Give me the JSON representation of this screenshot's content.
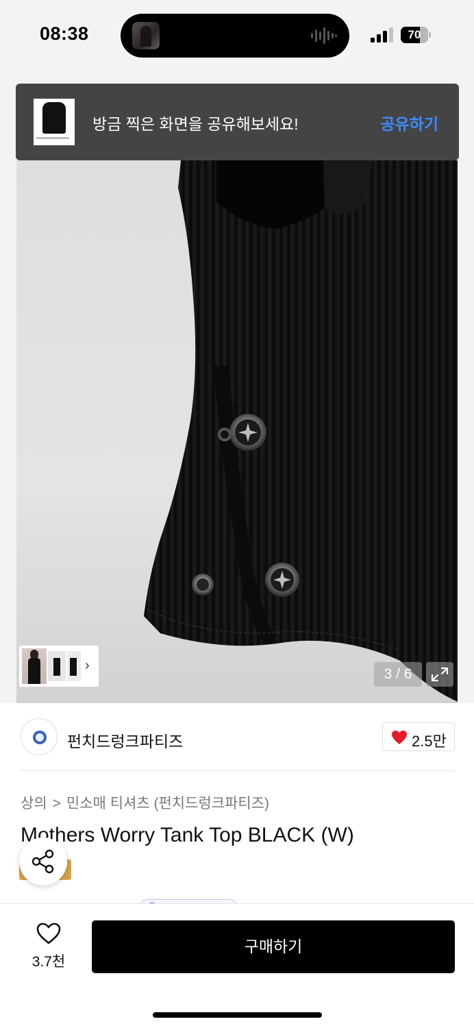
{
  "status_bar": {
    "time": "08:38",
    "battery_level": "70",
    "battery_fraction": 0.7,
    "signal_bars": 3
  },
  "share_toast": {
    "message": "방금 찍은 화면을 공유해보세요!",
    "action_label": "공유하기",
    "action_color": "#3d8bff"
  },
  "gallery": {
    "counter": "3 / 6",
    "thumbnail_chevron": "chevron-right-icon",
    "expand_icon": "expand-icon"
  },
  "brand": {
    "name": "펀치드렁크파티즈",
    "likes": "2.5만",
    "heart_color": "#e8192c"
  },
  "breadcrumb": {
    "category": "상의",
    "separator": ">",
    "subcategory": "민소매 티셔츠 (펀치드렁크파티즈)"
  },
  "product": {
    "title": "Mothers Worry Tank Top BLACK (W)"
  },
  "bottom_bar": {
    "wishlist_count": "3.7천",
    "buy_label": "구매하기"
  }
}
